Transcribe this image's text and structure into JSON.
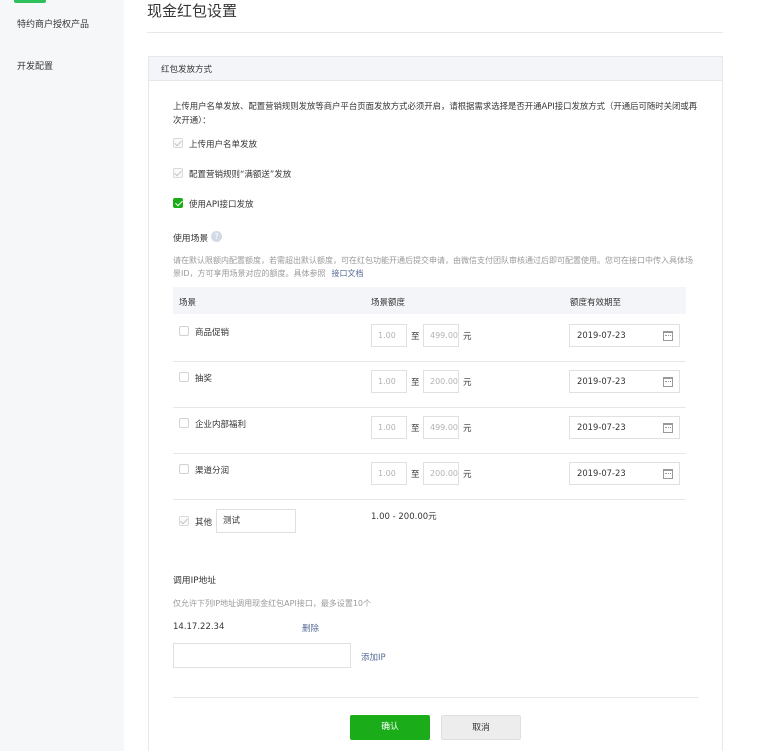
{
  "sidebar": {
    "items": [
      {
        "label": "特约商户授权产品"
      },
      {
        "label": "开发配置"
      }
    ]
  },
  "page": {
    "title": "现金红包设置"
  },
  "panel": {
    "header": "红包发放方式",
    "description": "上传用户名单发放、配置营销规则发放等商户平台页面发放方式必须开启，请根据需求选择是否开通API接口发放方式（开通后可随时关闭或再次开通）：",
    "options": [
      {
        "label": "上传用户名单发放",
        "state": "checked-disabled"
      },
      {
        "label": "配置营销规则“满额送”发放",
        "state": "checked-disabled"
      },
      {
        "label": "使用API接口发放",
        "state": "checked"
      }
    ]
  },
  "scenes": {
    "title": "使用场景",
    "help_icon": "question-circle-icon",
    "note": "请在默认限额内配置额度，若需超出默认额度，可在红包功能开通后提交申请，由微信支付团队审核通过后即可配置使用。您可在接口中传入具体场景ID，方可享用场景对应的额度。具体参照",
    "note_link": "接口文档",
    "columns": [
      "场景",
      "场景额度",
      "额度有效期至"
    ],
    "rows": [
      {
        "name": "商品促销",
        "min": "1.00",
        "max": "499.00",
        "to": "至",
        "unit": "元",
        "date": "2019-07-23"
      },
      {
        "name": "抽奖",
        "min": "1.00",
        "max": "200.00",
        "to": "至",
        "unit": "元",
        "date": "2019-07-23"
      },
      {
        "name": "企业内部福利",
        "min": "1.00",
        "max": "499.00",
        "to": "至",
        "unit": "元",
        "date": "2019-07-23"
      },
      {
        "name": "渠道分润",
        "min": "1.00",
        "max": "200.00",
        "to": "至",
        "unit": "元",
        "date": "2019-07-23"
      }
    ],
    "other": {
      "label": "其他",
      "value": "测试",
      "range": "1.00 - 200.00元"
    }
  },
  "ip": {
    "title": "调用IP地址",
    "note": "仅允许下列IP地址调用现金红包API接口，最多设置10个",
    "entries": [
      {
        "address": "14.17.22.34",
        "delete": "删除"
      }
    ],
    "add_label": "添加IP",
    "input_value": ""
  },
  "actions": {
    "confirm": "确认",
    "cancel": "取消"
  },
  "colors": {
    "accent": "#1aad19",
    "link": "#576b95",
    "sidebar_bg": "#f6f7f8"
  }
}
